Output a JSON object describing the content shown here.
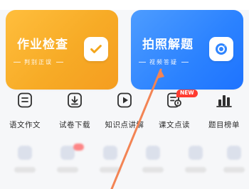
{
  "cards": {
    "left": {
      "title": "作业检查",
      "subtitle": "判别正误",
      "icon": "check-icon",
      "accent": "#f7ad28"
    },
    "right": {
      "title": "拍照解题",
      "subtitle": "视频答疑",
      "icon": "camera-icon",
      "accent": "#2f85ff"
    }
  },
  "tools": [
    {
      "label": "语文作文",
      "icon": "composition-icon"
    },
    {
      "label": "试卷下载",
      "icon": "download-icon"
    },
    {
      "label": "知识点讲解",
      "icon": "play-icon"
    },
    {
      "label": "课文点读",
      "icon": "read-icon",
      "badge": "NEW"
    },
    {
      "label": "题目榜单",
      "icon": "chart-icon"
    }
  ],
  "colors": {
    "background": "#f6f7f9",
    "arrow": "#f07a4a",
    "badge": "#ff3b30"
  }
}
